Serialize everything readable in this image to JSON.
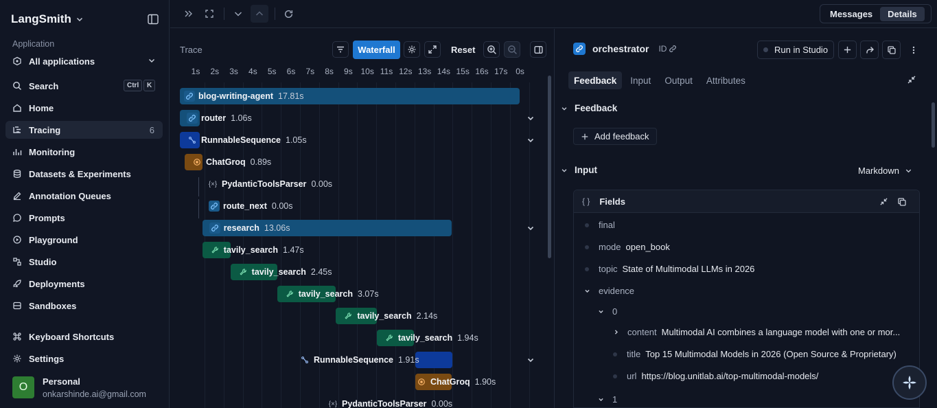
{
  "app": {
    "brand": "LangSmith"
  },
  "sidebar": {
    "section_label": "Application",
    "app_select": "All applications",
    "search": {
      "label": "Search",
      "kbd": [
        "Ctrl",
        "K"
      ]
    },
    "items": [
      {
        "label": "Home",
        "icon": "home-icon"
      },
      {
        "label": "Tracing",
        "icon": "tracing-icon",
        "count": "6",
        "active": true
      },
      {
        "label": "Monitoring",
        "icon": "monitoring-icon"
      },
      {
        "label": "Datasets & Experiments",
        "icon": "database-icon"
      },
      {
        "label": "Annotation Queues",
        "icon": "pen-icon"
      },
      {
        "label": "Prompts",
        "icon": "chat-icon"
      },
      {
        "label": "Playground",
        "icon": "play-icon"
      },
      {
        "label": "Studio",
        "icon": "studio-icon"
      },
      {
        "label": "Deployments",
        "icon": "rocket-icon"
      },
      {
        "label": "Sandboxes",
        "icon": "sandbox-icon"
      }
    ],
    "bottom": [
      {
        "label": "Keyboard Shortcuts",
        "icon": "command-icon"
      },
      {
        "label": "Settings",
        "icon": "gear-icon"
      }
    ],
    "profile": {
      "initial": "O",
      "name": "Personal",
      "email": "onkarshinde.ai@gmail.com"
    }
  },
  "topbar": {
    "segments": [
      "Messages",
      "Details"
    ],
    "active_segment": "Details"
  },
  "trace": {
    "title": "Trace",
    "waterfall_label": "Waterfall",
    "reset_label": "Reset",
    "ticks": [
      "1s",
      "2s",
      "3s",
      "4s",
      "5s",
      "6s",
      "7s",
      "8s",
      "9s",
      "10s",
      "11s",
      "12s",
      "13s",
      "14s",
      "15s",
      "16s",
      "17s",
      "0s"
    ],
    "runs": [
      {
        "name": "blog-writing-agent",
        "duration": "17.81s",
        "kind": "chain",
        "start": 0.0,
        "dur": 17.81,
        "depth": 0
      },
      {
        "name": "router",
        "duration": "1.06s",
        "kind": "chain",
        "start": 0.0,
        "dur": 1.06,
        "depth": 1,
        "expand": true
      },
      {
        "name": "RunnableSequence",
        "duration": "1.05s",
        "kind": "sequence",
        "start": 0.0,
        "dur": 1.05,
        "depth": 1,
        "expand": true
      },
      {
        "name": "ChatGroq",
        "duration": "0.89s",
        "kind": "llm",
        "start": 0.25,
        "dur": 0.89,
        "depth": 2
      },
      {
        "name": "PydanticToolsParser",
        "duration": "0.00s",
        "kind": "parser",
        "start": 1.14,
        "dur": 0.0,
        "depth": 3
      },
      {
        "name": "route_next",
        "duration": "0.00s",
        "kind": "chain",
        "start": 1.14,
        "dur": 0.0,
        "depth": 3
      },
      {
        "name": "research",
        "duration": "13.06s",
        "kind": "chain",
        "start": 1.18,
        "dur": 13.06,
        "depth": 1,
        "expand": true
      },
      {
        "name": "tavily_search",
        "duration": "1.47s",
        "kind": "tool",
        "start": 1.18,
        "dur": 1.47,
        "depth": 2
      },
      {
        "name": "tavily_search",
        "duration": "2.45s",
        "kind": "tool",
        "start": 2.65,
        "dur": 2.45,
        "depth": 2
      },
      {
        "name": "tavily_search",
        "duration": "3.07s",
        "kind": "tool",
        "start": 5.1,
        "dur": 3.07,
        "depth": 2
      },
      {
        "name": "tavily_search",
        "duration": "2.14s",
        "kind": "tool",
        "start": 8.18,
        "dur": 2.14,
        "depth": 2
      },
      {
        "name": "tavily_search",
        "duration": "1.94s",
        "kind": "tool",
        "start": 10.32,
        "dur": 1.94,
        "depth": 2
      },
      {
        "name": "RunnableSequence",
        "duration": "1.91s",
        "kind": "sequence",
        "start": 12.3,
        "dur": 1.91,
        "depth": 2,
        "expand": true
      },
      {
        "name": "ChatGroq",
        "duration": "1.90s",
        "kind": "llm",
        "start": 12.3,
        "dur": 1.9,
        "depth": 3
      },
      {
        "name": "PydanticToolsParser",
        "duration": "0.00s",
        "kind": "parser",
        "start": 14.2,
        "dur": 0.0,
        "depth": 4
      }
    ]
  },
  "details": {
    "title": "orchestrator",
    "id_label": "ID",
    "run_in_studio": "Run in Studio",
    "tabs": [
      "Feedback",
      "Input",
      "Output",
      "Attributes"
    ],
    "active_tab": "Feedback",
    "feedback_section": "Feedback",
    "add_feedback": "Add feedback",
    "input_section": "Input",
    "format_select": "Markdown",
    "fields_title": "Fields",
    "fields_braces": "{ }",
    "fields": {
      "final": {
        "key": "final"
      },
      "mode": {
        "key": "mode",
        "value": "open_book"
      },
      "topic": {
        "key": "topic",
        "value": "State of Multimodal LLMs in 2026"
      },
      "evidence": {
        "key": "evidence"
      },
      "idx0": "0",
      "content": {
        "key": "content",
        "value": "Multimodal AI combines a language model with one or mor..."
      },
      "title": {
        "key": "title",
        "value": "Top 15 Multimodal Models in 2026 (Open Source & Proprietary)"
      },
      "url": {
        "key": "url",
        "value": "https://blog.unitlab.ai/top-multimodal-models/"
      },
      "idx1": "1"
    }
  },
  "colors": {
    "accent": "#1f78d1",
    "chain_bar": "#14507a",
    "sequence_bar": "#0d3a9b",
    "tool_bar": "#0b5a44",
    "llm_bar": "#7a4a12"
  }
}
